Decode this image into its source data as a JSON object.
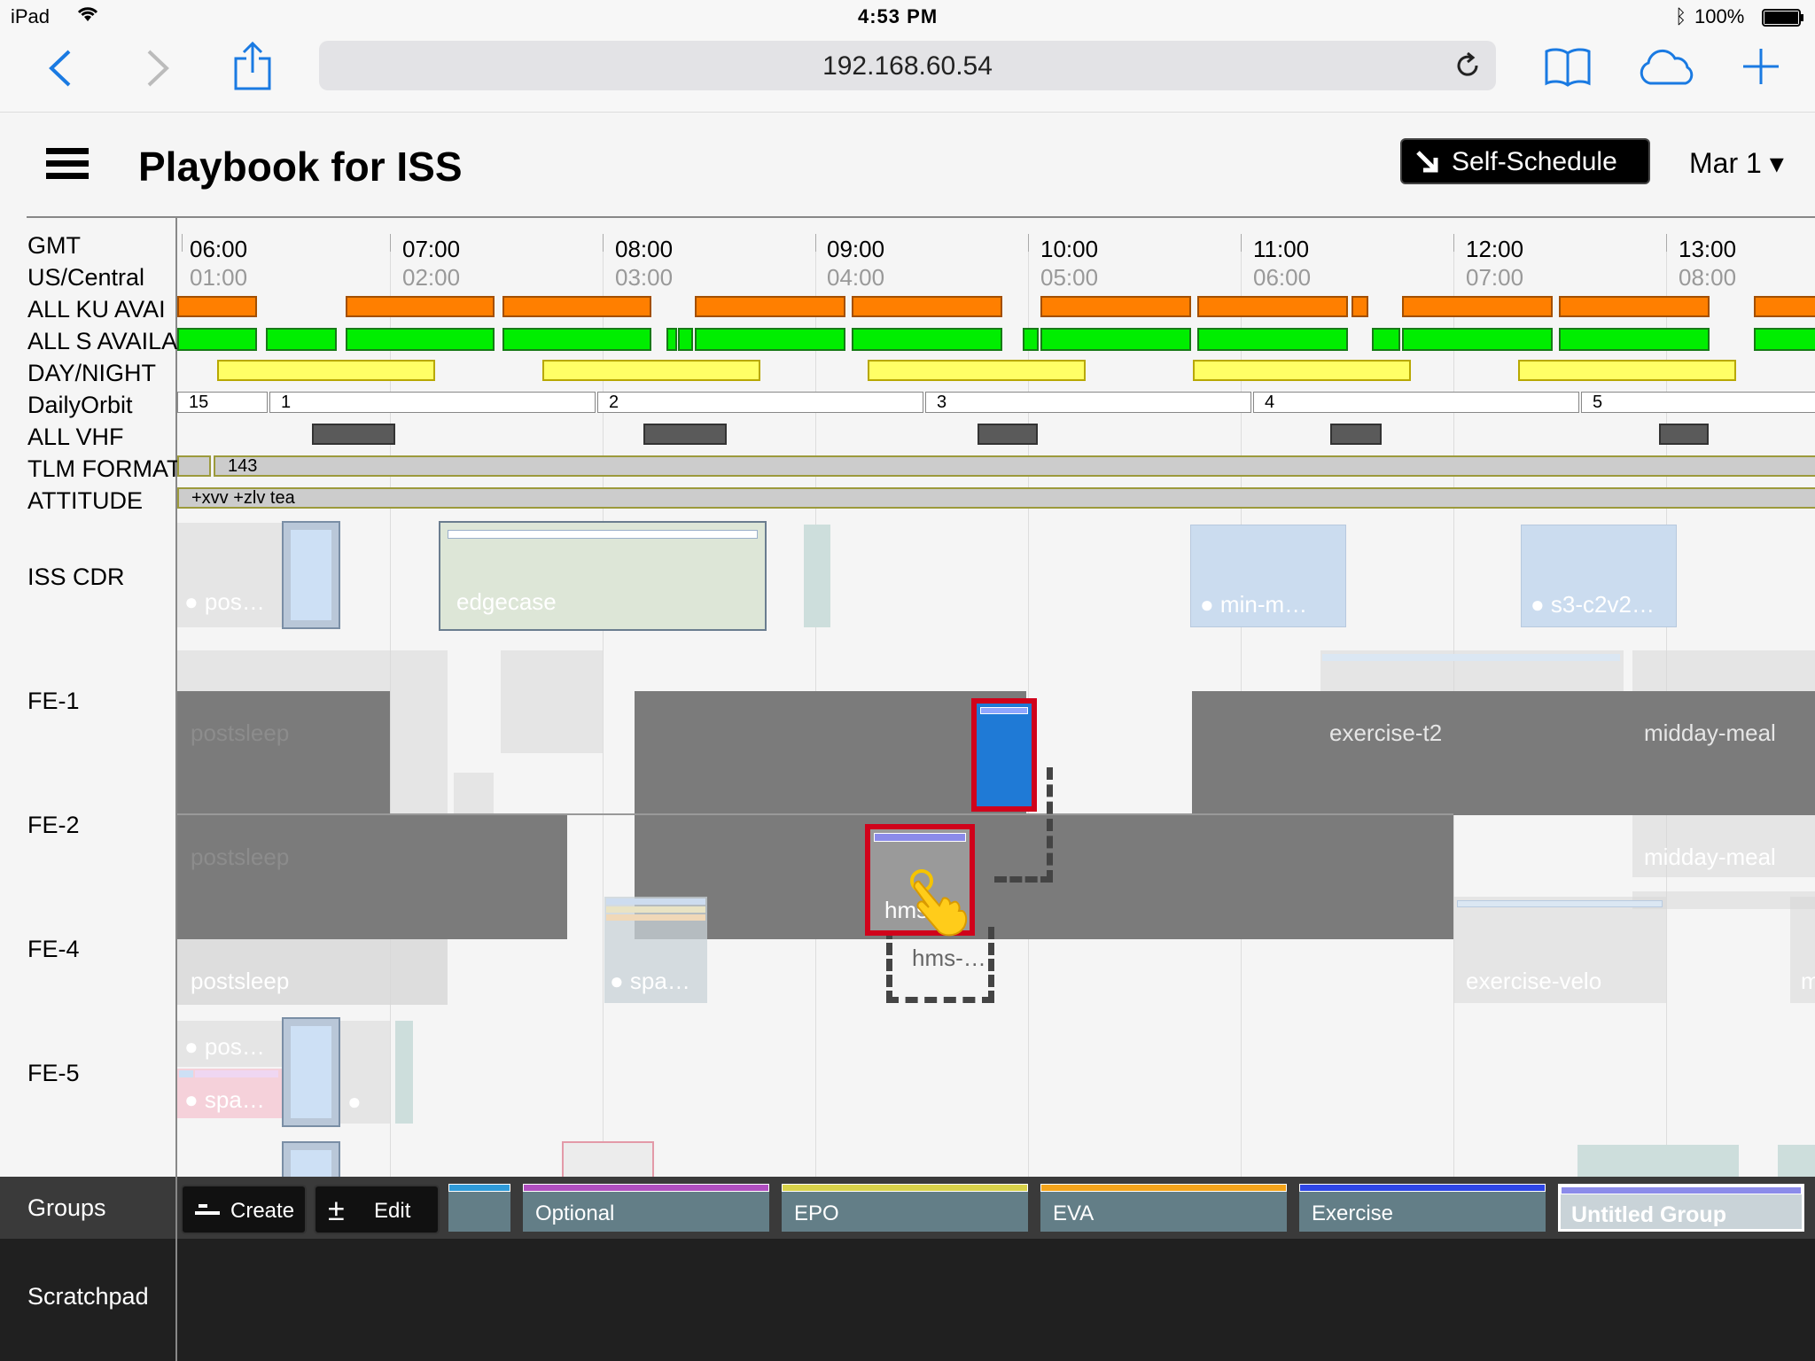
{
  "status_bar": {
    "device": "iPad",
    "time": "4:53 PM",
    "battery": "100%"
  },
  "browser": {
    "url": "192.168.60.54"
  },
  "app": {
    "title": "Playbook for ISS",
    "self_schedule_label": "Self-Schedule",
    "date": "Mar 1 ▾"
  },
  "rows": {
    "gmt": "GMT",
    "us_central": "US/Central",
    "ku": "ALL KU AVAI",
    "s_band": "ALL S AVAILA",
    "day_night": "DAY/NIGHT",
    "daily_orbit": "DailyOrbit",
    "vhf": "ALL VHF",
    "tlm": "TLM FORMAT",
    "attitude": "ATTITUDE",
    "iss_cdr": "ISS CDR",
    "fe1": "FE-1",
    "fe2": "FE-2",
    "fe4": "FE-4",
    "fe5": "FE-5"
  },
  "gmt_times": [
    "06:00",
    "07:00",
    "08:00",
    "09:00",
    "10:00",
    "11:00",
    "12:00",
    "13:00"
  ],
  "local_times": [
    "01:00",
    "02:00",
    "03:00",
    "04:00",
    "05:00",
    "06:00",
    "07:00",
    "08:00"
  ],
  "orbits": [
    "15",
    "1",
    "2",
    "3",
    "4",
    "5"
  ],
  "tlm_value": "143",
  "attitude_value": "+xvv +zlv tea",
  "activities": {
    "iss_cdr_pos": "● pos…",
    "edgecase": "edgecase",
    "min_m": "● min-m…",
    "s3": "● s3-c2v2…",
    "fe1_postsleep": "postsleep",
    "fe1_exercise": "exercise-t2",
    "fe1_midday": "midday-meal",
    "fe2_postsleep": "postsleep",
    "fe2_midday": "midday-meal",
    "fe2_hms": "hms",
    "fe4_postsleep": "postsleep",
    "fe4_spa": "● spa…",
    "fe4_hms_ghost": "hms-…",
    "fe4_exercise_velo": "exercise-velo",
    "fe4_m": "m",
    "fe5_pos": "● pos…",
    "fe5_spa": "● spa…",
    "fe5_dot": "●"
  },
  "groups": {
    "label": "Groups",
    "create": "Create",
    "edit": "Edit",
    "chips": [
      {
        "name": "Optional",
        "color": "#b04fc0"
      },
      {
        "name": "EPO",
        "color": "#d8d24a"
      },
      {
        "name": "EVA",
        "color": "#f3a31a"
      },
      {
        "name": "Exercise",
        "color": "#2e46e6"
      },
      {
        "name": "Untitled Group",
        "color": "#8b8bea"
      }
    ]
  },
  "scratchpad_label": "Scratchpad",
  "colors": {
    "accent": "#1a7ae2",
    "ku": "#ff7f00",
    "s_band": "#00ee00",
    "day_night": "#ffff66",
    "selected": "#d0021b",
    "selected_fill": "#1f7ad6"
  }
}
